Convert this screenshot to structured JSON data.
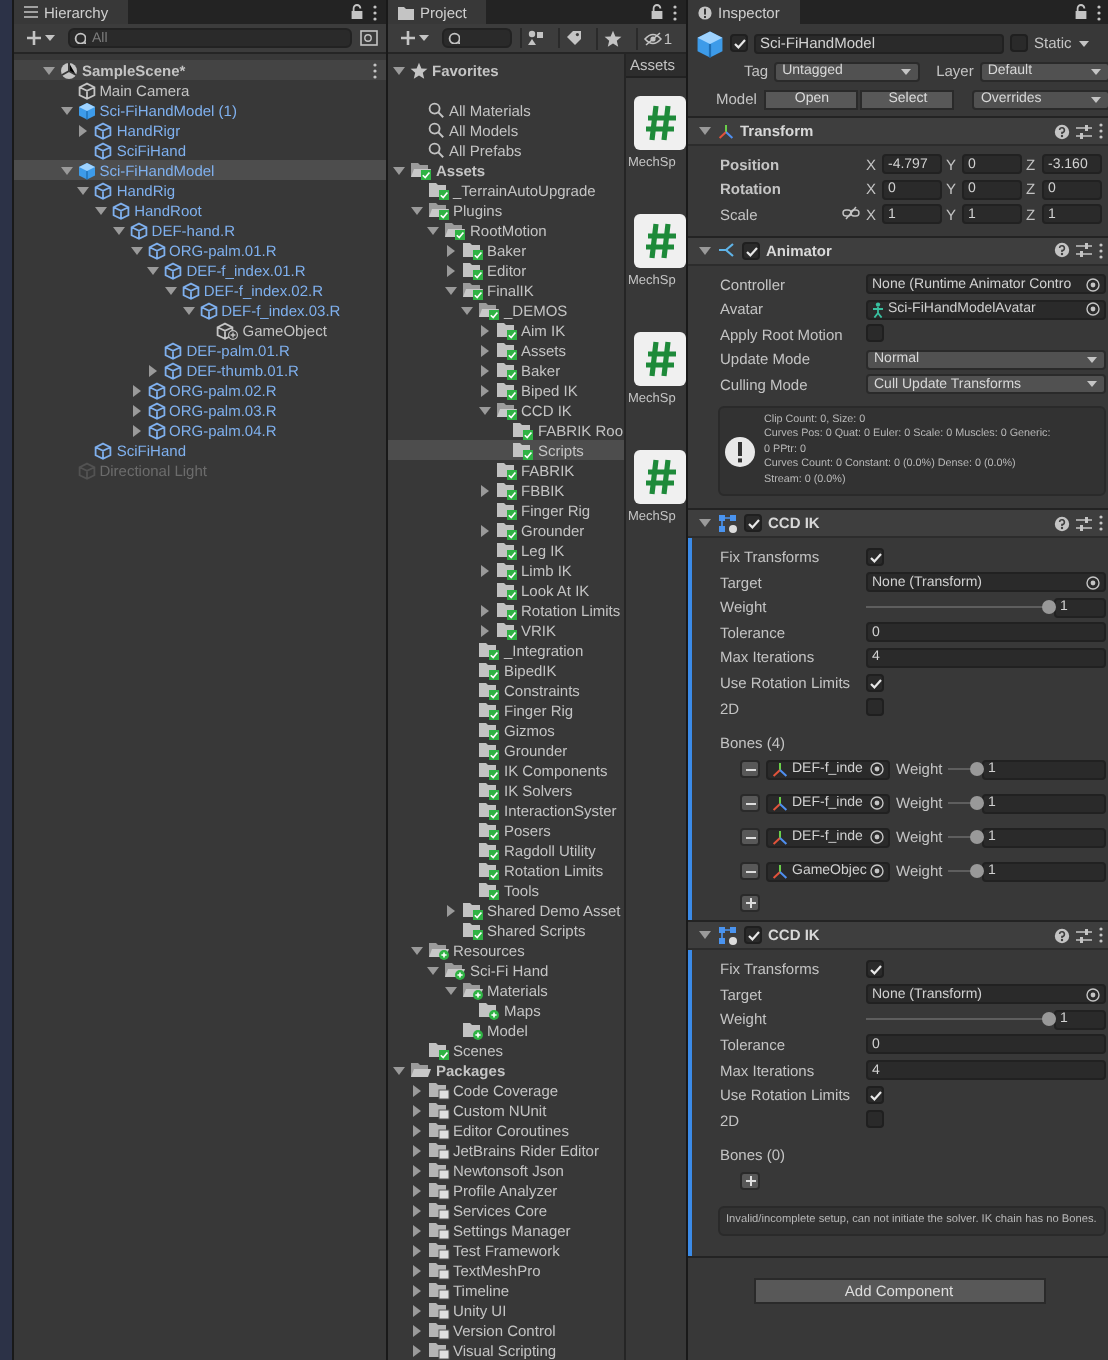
{
  "hierarchy": {
    "title": "Hierarchy",
    "search": {
      "placeholder": "All"
    },
    "items": [
      {
        "label": "SampleScene*",
        "kind": "scene",
        "expanded": true,
        "selected": false,
        "children": [
          {
            "label": "Main Camera",
            "kind": "object",
            "selected": false
          },
          {
            "label": "Sci-FiHandModel (1)",
            "kind": "prefab-root",
            "expanded": true,
            "selected": false,
            "children": [
              {
                "label": "HandRigr",
                "kind": "prefab",
                "expanded": false,
                "selected": false
              },
              {
                "label": "SciFiHand",
                "kind": "prefab",
                "selected": false
              }
            ]
          },
          {
            "label": "Sci-FiHandModel",
            "kind": "prefab-root",
            "expanded": true,
            "selected": true,
            "children": [
              {
                "label": "HandRig",
                "kind": "prefab",
                "expanded": true,
                "selected": false,
                "children": [
                  {
                    "label": "HandRoot",
                    "kind": "prefab",
                    "expanded": true,
                    "selected": false,
                    "children": [
                      {
                        "label": "DEF-hand.R",
                        "kind": "prefab",
                        "expanded": true,
                        "selected": false,
                        "children": [
                          {
                            "label": "ORG-palm.01.R",
                            "kind": "prefab",
                            "expanded": true,
                            "selected": false,
                            "children": [
                              {
                                "label": "DEF-f_index.01.R",
                                "kind": "prefab",
                                "expanded": true,
                                "selected": false,
                                "children": [
                                  {
                                    "label": "DEF-f_index.02.R",
                                    "kind": "prefab",
                                    "expanded": true,
                                    "selected": false,
                                    "children": [
                                      {
                                        "label": "DEF-f_index.03.R",
                                        "kind": "prefab",
                                        "expanded": true,
                                        "selected": false,
                                        "children": [
                                          {
                                            "label": "GameObject",
                                            "kind": "added",
                                            "selected": false
                                          }
                                        ]
                                      }
                                    ]
                                  }
                                ]
                              },
                              {
                                "label": "DEF-palm.01.R",
                                "kind": "prefab",
                                "selected": false
                              },
                              {
                                "label": "DEF-thumb.01.R",
                                "kind": "prefab",
                                "expanded": false,
                                "selected": false
                              }
                            ]
                          },
                          {
                            "label": "ORG-palm.02.R",
                            "kind": "prefab",
                            "expanded": false,
                            "selected": false
                          },
                          {
                            "label": "ORG-palm.03.R",
                            "kind": "prefab",
                            "expanded": false,
                            "selected": false
                          },
                          {
                            "label": "ORG-palm.04.R",
                            "kind": "prefab",
                            "expanded": false,
                            "selected": false
                          }
                        ]
                      }
                    ]
                  }
                ]
              },
              {
                "label": "SciFiHand",
                "kind": "prefab",
                "selected": false
              }
            ]
          },
          {
            "label": "Directional Light",
            "kind": "disabled",
            "selected": false
          }
        ]
      }
    ]
  },
  "project": {
    "title": "Project",
    "hidden_count": "1",
    "tree": [
      {
        "label": "Favorites",
        "kind": "favorites",
        "expanded": true,
        "selected": false,
        "children": [
          {
            "label": "All Materials",
            "kind": "search",
            "selected": false
          },
          {
            "label": "All Models",
            "kind": "search",
            "selected": false
          },
          {
            "label": "All Prefabs",
            "kind": "search",
            "selected": false
          }
        ]
      },
      {
        "label": "Assets",
        "kind": "folder",
        "expanded": true,
        "selected": false,
        "children": [
          {
            "label": "_TerrainAutoUpgrade",
            "kind": "folder",
            "selected": false
          },
          {
            "label": "Plugins",
            "kind": "folder",
            "expanded": true,
            "selected": false,
            "children": [
              {
                "label": "RootMotion",
                "kind": "folder",
                "expanded": true,
                "selected": false,
                "children": [
                  {
                    "label": "Baker",
                    "kind": "folder",
                    "expanded": false,
                    "selected": false
                  },
                  {
                    "label": "Editor",
                    "kind": "folder",
                    "expanded": false,
                    "selected": false
                  },
                  {
                    "label": "FinalIK",
                    "kind": "folder",
                    "expanded": true,
                    "selected": false,
                    "children": [
                      {
                        "label": "_DEMOS",
                        "kind": "folder",
                        "expanded": true,
                        "selected": false,
                        "children": [
                          {
                            "label": "Aim IK",
                            "kind": "folder",
                            "expanded": false,
                            "selected": false
                          },
                          {
                            "label": "Assets",
                            "kind": "folder",
                            "expanded": false,
                            "selected": false
                          },
                          {
                            "label": "Baker",
                            "kind": "folder",
                            "expanded": false,
                            "selected": false
                          },
                          {
                            "label": "Biped IK",
                            "kind": "folder",
                            "expanded": false,
                            "selected": false
                          },
                          {
                            "label": "CCD IK",
                            "kind": "folder",
                            "expanded": true,
                            "selected": false,
                            "children": [
                              {
                                "label": "FABRIK Roo",
                                "kind": "folder",
                                "selected": false
                              },
                              {
                                "label": "Scripts",
                                "kind": "folder",
                                "selected": true
                              }
                            ]
                          },
                          {
                            "label": "FABRIK",
                            "kind": "folder",
                            "selected": false
                          },
                          {
                            "label": "FBBIK",
                            "kind": "folder",
                            "expanded": false,
                            "selected": false
                          },
                          {
                            "label": "Finger Rig",
                            "kind": "folder",
                            "selected": false
                          },
                          {
                            "label": "Grounder",
                            "kind": "folder",
                            "expanded": false,
                            "selected": false
                          },
                          {
                            "label": "Leg IK",
                            "kind": "folder",
                            "selected": false
                          },
                          {
                            "label": "Limb IK",
                            "kind": "folder",
                            "expanded": false,
                            "selected": false
                          },
                          {
                            "label": "Look At IK",
                            "kind": "folder",
                            "selected": false
                          },
                          {
                            "label": "Rotation Limits",
                            "kind": "folder",
                            "expanded": false,
                            "selected": false
                          },
                          {
                            "label": "VRIK",
                            "kind": "folder",
                            "expanded": false,
                            "selected": false
                          }
                        ]
                      },
                      {
                        "label": "_Integration",
                        "kind": "folder",
                        "selected": false
                      },
                      {
                        "label": "BipedIK",
                        "kind": "folder",
                        "selected": false
                      },
                      {
                        "label": "Constraints",
                        "kind": "folder",
                        "selected": false
                      },
                      {
                        "label": "Finger Rig",
                        "kind": "folder",
                        "selected": false
                      },
                      {
                        "label": "Gizmos",
                        "kind": "folder",
                        "selected": false
                      },
                      {
                        "label": "Grounder",
                        "kind": "folder",
                        "selected": false
                      },
                      {
                        "label": "IK Components",
                        "kind": "folder",
                        "selected": false
                      },
                      {
                        "label": "IK Solvers",
                        "kind": "folder",
                        "selected": false
                      },
                      {
                        "label": "InteractionSyster",
                        "kind": "folder",
                        "selected": false
                      },
                      {
                        "label": "Posers",
                        "kind": "folder",
                        "selected": false
                      },
                      {
                        "label": "Ragdoll Utility",
                        "kind": "folder",
                        "selected": false
                      },
                      {
                        "label": "Rotation Limits",
                        "kind": "folder",
                        "selected": false
                      },
                      {
                        "label": "Tools",
                        "kind": "folder",
                        "selected": false
                      }
                    ]
                  },
                  {
                    "label": "Shared Demo Asset",
                    "kind": "folder",
                    "expanded": false,
                    "selected": false
                  },
                  {
                    "label": "Shared Scripts",
                    "kind": "folder",
                    "selected": false
                  }
                ]
              }
            ]
          },
          {
            "label": "Resources",
            "kind": "folder-new",
            "expanded": true,
            "selected": false,
            "children": [
              {
                "label": "Sci-Fi Hand",
                "kind": "folder-new",
                "expanded": true,
                "selected": false,
                "children": [
                  {
                    "label": "Materials",
                    "kind": "folder-new",
                    "expanded": true,
                    "selected": false,
                    "children": [
                      {
                        "label": "Maps",
                        "kind": "folder-new",
                        "selected": false
                      }
                    ]
                  },
                  {
                    "label": "Model",
                    "kind": "folder-new",
                    "selected": false
                  }
                ]
              }
            ]
          },
          {
            "label": "Scenes",
            "kind": "folder",
            "selected": false
          }
        ]
      },
      {
        "label": "Packages",
        "kind": "package-root",
        "expanded": true,
        "selected": false,
        "children": [
          {
            "label": "Code Coverage",
            "kind": "package",
            "expanded": false,
            "selected": false
          },
          {
            "label": "Custom NUnit",
            "kind": "package",
            "expanded": false,
            "selected": false
          },
          {
            "label": "Editor Coroutines",
            "kind": "package",
            "expanded": false,
            "selected": false
          },
          {
            "label": "JetBrains Rider Editor",
            "kind": "package",
            "expanded": false,
            "selected": false
          },
          {
            "label": "Newtonsoft Json",
            "kind": "package",
            "expanded": false,
            "selected": false
          },
          {
            "label": "Profile Analyzer",
            "kind": "package",
            "expanded": false,
            "selected": false
          },
          {
            "label": "Services Core",
            "kind": "package",
            "expanded": false,
            "selected": false
          },
          {
            "label": "Settings Manager",
            "kind": "package",
            "expanded": false,
            "selected": false
          },
          {
            "label": "Test Framework",
            "kind": "package",
            "expanded": false,
            "selected": false
          },
          {
            "label": "TextMeshPro",
            "kind": "package",
            "expanded": false,
            "selected": false
          },
          {
            "label": "Timeline",
            "kind": "package",
            "expanded": false,
            "selected": false
          },
          {
            "label": "Unity UI",
            "kind": "package",
            "expanded": false,
            "selected": false
          },
          {
            "label": "Version Control",
            "kind": "package",
            "expanded": false,
            "selected": false
          },
          {
            "label": "Visual Scripting",
            "kind": "package",
            "expanded": false,
            "selected": false
          }
        ]
      }
    ],
    "assets": {
      "breadcrumb": "Assets",
      "items": [
        {
          "label": "MechSp"
        },
        {
          "label": "MechSp"
        },
        {
          "label": "MechSp"
        },
        {
          "label": "MechSp"
        }
      ]
    }
  },
  "inspector": {
    "title": "Inspector",
    "object": {
      "name": "Sci-FiHandModel",
      "active": true,
      "static": false,
      "static_label": "Static",
      "tag_label": "Tag",
      "tag": "Untagged",
      "layer_label": "Layer",
      "layer": "Default",
      "model_label": "Model",
      "model_buttons": [
        "Open",
        "Select"
      ],
      "overrides": "Overrides"
    },
    "components": [
      {
        "kind": "transform",
        "title": "Transform",
        "expanded": true,
        "added": false,
        "rows": [
          {
            "label": "Position",
            "kind": "vector",
            "overridden": true,
            "values": [
              {
                "axis": "X",
                "value": "-4.797"
              },
              {
                "axis": "Y",
                "value": "0"
              },
              {
                "axis": "Z",
                "value": "-3.160"
              }
            ]
          },
          {
            "label": "Rotation",
            "kind": "vector",
            "overridden": true,
            "values": [
              {
                "axis": "X",
                "value": "0"
              },
              {
                "axis": "Y",
                "value": "0"
              },
              {
                "axis": "Z",
                "value": "0"
              }
            ]
          },
          {
            "label": "Scale",
            "kind": "scale",
            "overridden": false,
            "values": [
              {
                "axis": "X",
                "value": "1"
              },
              {
                "axis": "Y",
                "value": "1"
              },
              {
                "axis": "Z",
                "value": "1"
              }
            ]
          }
        ]
      },
      {
        "kind": "animator",
        "title": "Animator",
        "enabled": true,
        "expanded": true,
        "added": false,
        "fields": [
          {
            "label": "Controller",
            "kind": "object",
            "value": "None (Runtime Animator Contro"
          },
          {
            "label": "Avatar",
            "kind": "asset",
            "value": "Sci-FiHandModelAvatar"
          },
          {
            "label": "Apply Root Motion",
            "kind": "checkbox",
            "checked": false
          },
          {
            "label": "Update Mode",
            "kind": "dropdown",
            "value": "Normal"
          },
          {
            "label": "Culling Mode",
            "kind": "dropdown",
            "value": "Cull Update Transforms"
          }
        ],
        "info": [
          "Clip Count: 0, Size: 0",
          "Curves Pos: 0 Quat: 0 Euler: 0 Scale: 0 Muscles: 0 Generic:",
          "0 PPtr: 0",
          "Curves Count: 0 Constant: 0 (0.0%) Dense: 0 (0.0%)",
          "Stream: 0 (0.0%)"
        ]
      },
      {
        "kind": "ik",
        "title": "CCD IK",
        "enabled": true,
        "expanded": true,
        "added": true,
        "fields": [
          {
            "label": "Fix Transforms",
            "kind": "checkbox",
            "checked": true
          },
          {
            "label": "Target",
            "kind": "object",
            "value": "None (Transform)"
          },
          {
            "label": "Weight",
            "kind": "slider",
            "level": 1,
            "value": "1"
          },
          {
            "label": "Tolerance",
            "kind": "number",
            "value": "0"
          },
          {
            "label": "Max Iterations",
            "kind": "number",
            "value": "4"
          },
          {
            "label": "Use Rotation Limits",
            "kind": "checkbox",
            "checked": true
          },
          {
            "label": "2D",
            "kind": "checkbox",
            "checked": false
          }
        ],
        "bones_label": "Bones (4)",
        "bones": [
          {
            "name": "DEF-f_inde",
            "weight_label": "Weight",
            "level": 1,
            "value": "1"
          },
          {
            "name": "DEF-f_inde",
            "weight_label": "Weight",
            "level": 1,
            "value": "1"
          },
          {
            "name": "DEF-f_inde",
            "weight_label": "Weight",
            "level": 1,
            "value": "1"
          },
          {
            "name": "GameObjec",
            "weight_label": "Weight",
            "level": 1,
            "value": "1"
          }
        ]
      },
      {
        "kind": "ik",
        "title": "CCD IK",
        "enabled": true,
        "expanded": true,
        "added": true,
        "fields": [
          {
            "label": "Fix Transforms",
            "kind": "checkbox",
            "checked": true
          },
          {
            "label": "Target",
            "kind": "object",
            "value": "None (Transform)"
          },
          {
            "label": "Weight",
            "kind": "slider",
            "level": 1,
            "value": "1"
          },
          {
            "label": "Tolerance",
            "kind": "number",
            "value": "0"
          },
          {
            "label": "Max Iterations",
            "kind": "number",
            "value": "4"
          },
          {
            "label": "Use Rotation Limits",
            "kind": "checkbox",
            "checked": true
          },
          {
            "label": "2D",
            "kind": "checkbox",
            "checked": false
          }
        ],
        "bones_label": "Bones (0)",
        "warning": "Invalid/incomplete setup, can not initiate the solver. IK chain has no Bones."
      }
    ],
    "add_component": "Add Component"
  }
}
